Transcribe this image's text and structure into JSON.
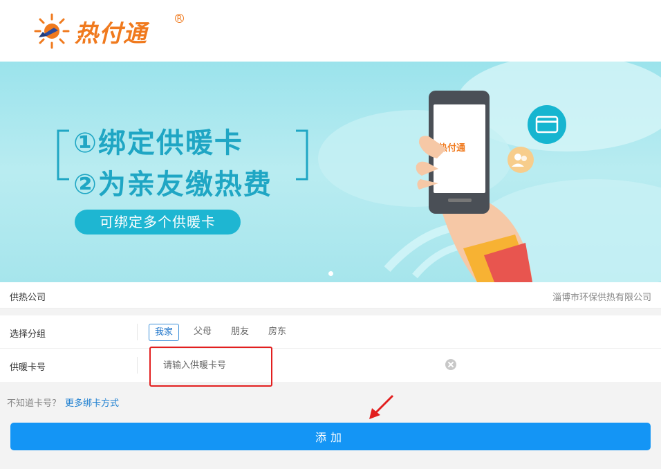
{
  "header": {
    "brand": "热付通"
  },
  "banner": {
    "line1": "①绑定供暖卡",
    "line2": "②为亲友缴热费",
    "pill": "可绑定多个供暖卡",
    "phone_brand": "热付通",
    "colors": {
      "text": "#1fa6c4",
      "pill": "#1eb6d2"
    }
  },
  "company": {
    "label": "供热公司",
    "value": "淄博市环保供热有限公司"
  },
  "group": {
    "label": "选择分组",
    "options": [
      "我家",
      "父母",
      "朋友",
      "房东"
    ],
    "selected": "我家"
  },
  "card": {
    "label": "供暖卡号",
    "placeholder": "请输入供暖卡号",
    "value": ""
  },
  "hint": {
    "text": "不知道卡号？",
    "link": "更多绑卡方式"
  },
  "submit": {
    "label": "添加"
  },
  "colors": {
    "primary": "#1495f5",
    "brand": "#f07a1e",
    "annotation": "#e21f1f"
  }
}
